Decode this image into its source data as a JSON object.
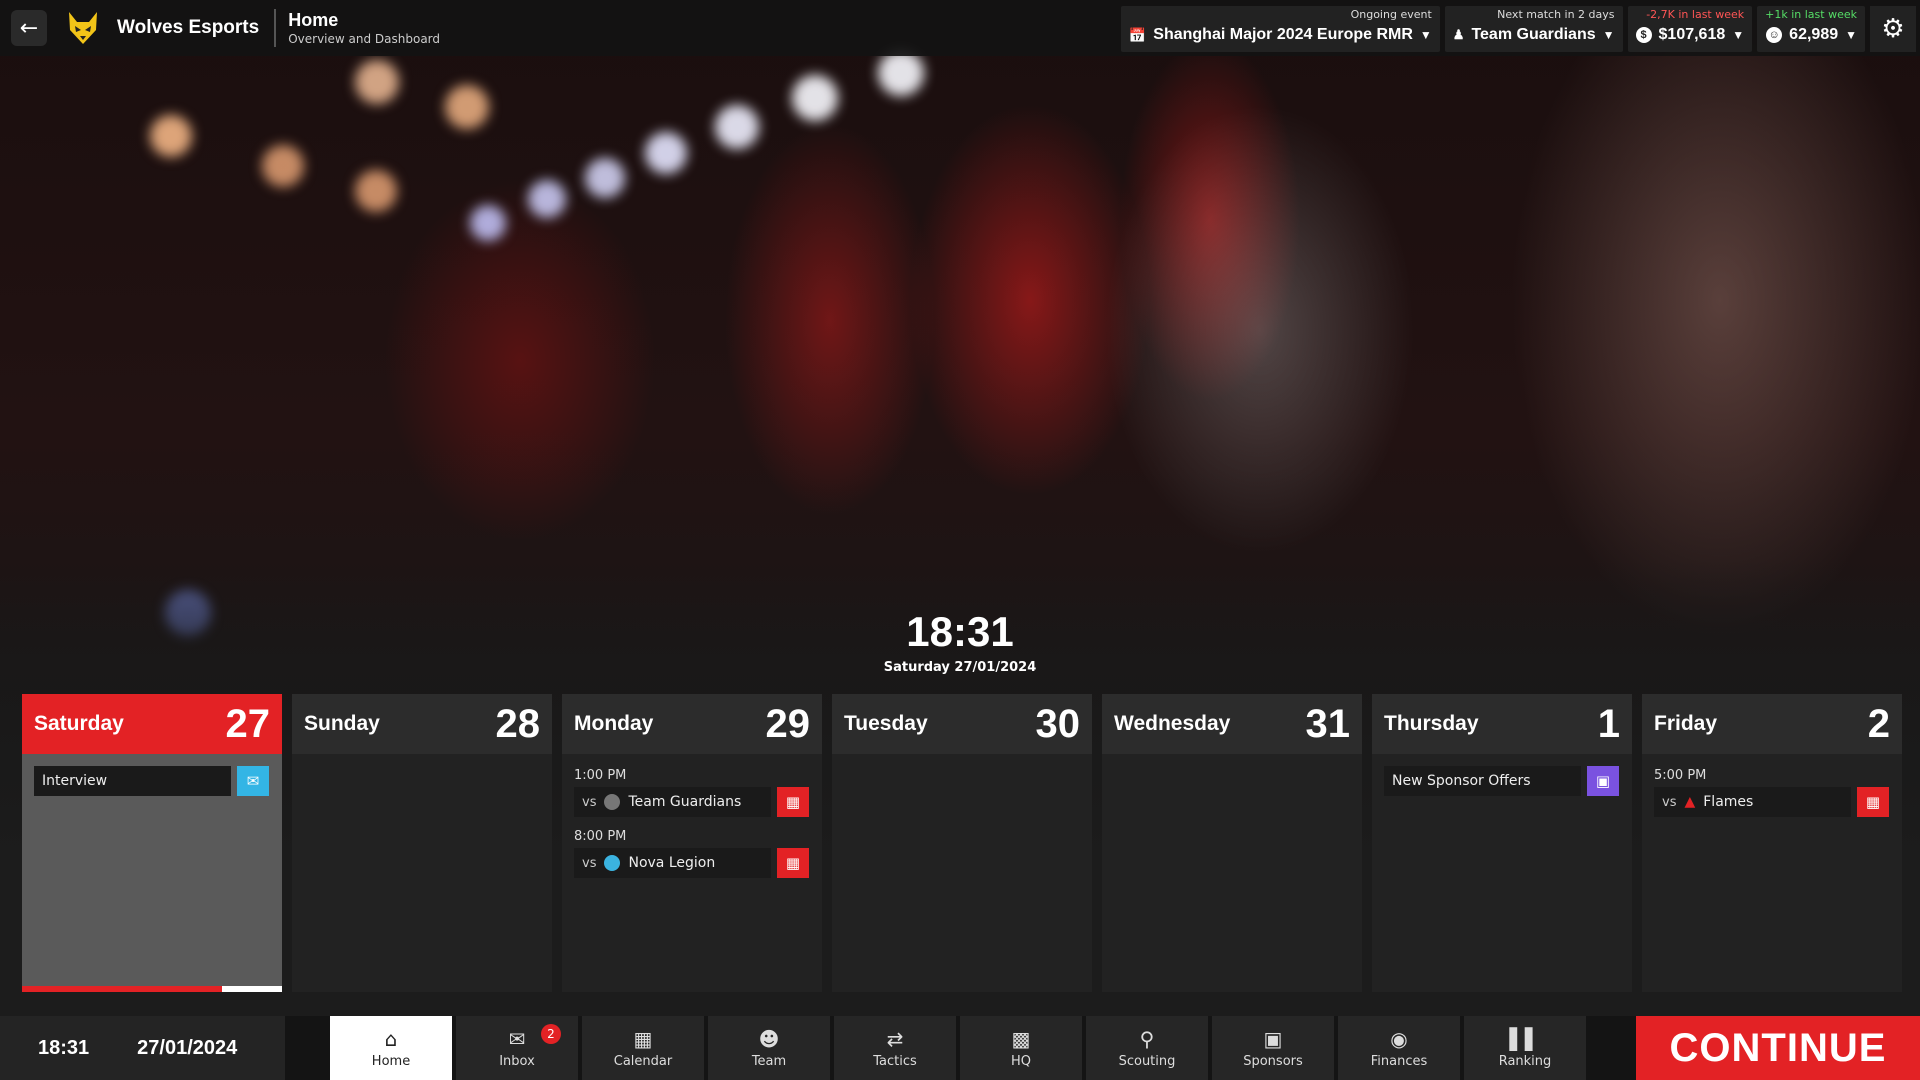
{
  "header": {
    "team_name": "Wolves Esports",
    "page_title": "Home",
    "page_subtitle": "Overview and Dashboard"
  },
  "widgets": {
    "event": {
      "caption": "Ongoing event",
      "value": "Shanghai Major 2024 Europe RMR"
    },
    "next_match": {
      "caption": "Next match in 2 days",
      "value": "Team Guardians"
    },
    "money": {
      "caption": "-2,7K in last week",
      "value": "$107,618"
    },
    "fans": {
      "caption": "+1k in last week",
      "value": "62,989"
    }
  },
  "clock": {
    "time": "18:31",
    "date": "Saturday 27/01/2024"
  },
  "days": [
    {
      "name": "Saturday",
      "num": "27",
      "events": [
        {
          "label": "Interview",
          "button": "mail"
        }
      ]
    },
    {
      "name": "Sunday",
      "num": "28"
    },
    {
      "name": "Monday",
      "num": "29",
      "events": [
        {
          "time": "1:00 PM",
          "vs": "vs",
          "opponent": "Team Guardians"
        },
        {
          "time": "8:00 PM",
          "vs": "vs",
          "opponent": "Nova Legion"
        }
      ]
    },
    {
      "name": "Tuesday",
      "num": "30"
    },
    {
      "name": "Wednesday",
      "num": "31"
    },
    {
      "name": "Thursday",
      "num": "1",
      "events": [
        {
          "label": "New Sponsor Offers"
        }
      ]
    },
    {
      "name": "Friday",
      "num": "2",
      "events": [
        {
          "time": "5:00 PM",
          "vs": "vs",
          "opponent": "Flames"
        }
      ]
    }
  ],
  "day_progress": 0.77,
  "bottom": {
    "time": "18:31",
    "date": "27/01/2024",
    "continue": "CONTINUE"
  },
  "nav": [
    {
      "label": "Home",
      "icon": "home-icon"
    },
    {
      "label": "Inbox",
      "icon": "envelope-icon",
      "badge": "2"
    },
    {
      "label": "Calendar",
      "icon": "calendar-icon"
    },
    {
      "label": "Team",
      "icon": "team-icon"
    },
    {
      "label": "Tactics",
      "icon": "tactics-icon"
    },
    {
      "label": "HQ",
      "icon": "building-icon"
    },
    {
      "label": "Scouting",
      "icon": "magnifier-icon"
    },
    {
      "label": "Sponsors",
      "icon": "briefcase-icon"
    },
    {
      "label": "Finances",
      "icon": "coins-icon"
    },
    {
      "label": "Ranking",
      "icon": "bar-chart-icon"
    }
  ],
  "colors": {
    "accent": "#e32225",
    "mail_button": "#33b5e5",
    "sponsor_button": "#7a52e0"
  }
}
